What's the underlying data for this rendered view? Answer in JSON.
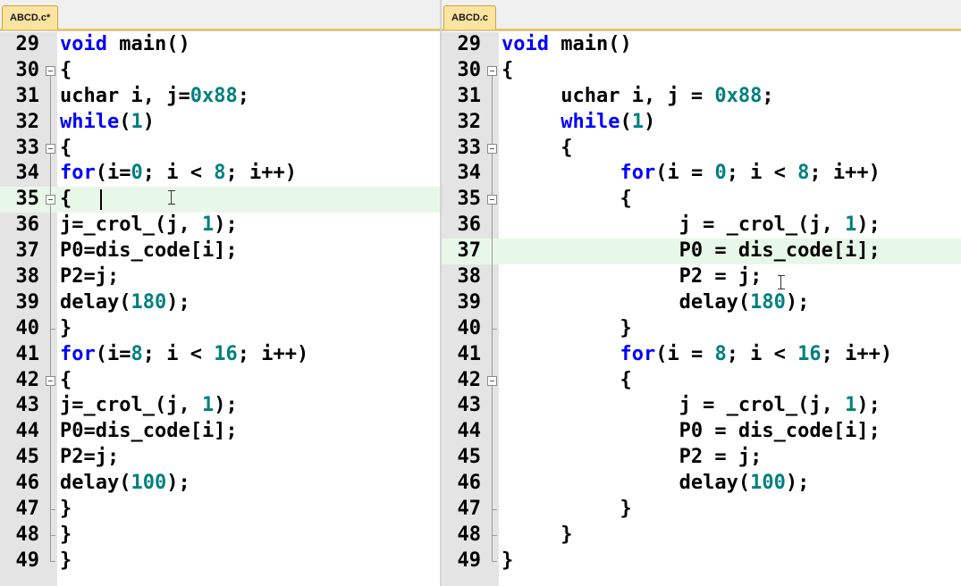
{
  "left_editor": {
    "tab_label": "ABCD.c*",
    "highlight_line": 35,
    "lines": [
      {
        "n": "29",
        "fold": "none",
        "t": [
          {
            "k": "kw",
            "v": "void"
          },
          {
            "k": "p",
            "v": " main()"
          }
        ]
      },
      {
        "n": "30",
        "fold": "open",
        "t": [
          {
            "k": "p",
            "v": "{"
          }
        ]
      },
      {
        "n": "31",
        "fold": "line",
        "t": [
          {
            "k": "p",
            "v": "uchar i, j="
          },
          {
            "k": "num",
            "v": "0x88"
          },
          {
            "k": "p",
            "v": ";"
          }
        ]
      },
      {
        "n": "32",
        "fold": "line",
        "t": [
          {
            "k": "kw",
            "v": "while"
          },
          {
            "k": "p",
            "v": "("
          },
          {
            "k": "num",
            "v": "1"
          },
          {
            "k": "p",
            "v": ")"
          }
        ]
      },
      {
        "n": "33",
        "fold": "open",
        "t": [
          {
            "k": "p",
            "v": "{"
          }
        ]
      },
      {
        "n": "34",
        "fold": "line",
        "t": [
          {
            "k": "kw",
            "v": "for"
          },
          {
            "k": "p",
            "v": "(i="
          },
          {
            "k": "num",
            "v": "0"
          },
          {
            "k": "p",
            "v": "; i < "
          },
          {
            "k": "num",
            "v": "8"
          },
          {
            "k": "p",
            "v": "; i++)"
          }
        ]
      },
      {
        "n": "35",
        "fold": "open",
        "t": [
          {
            "k": "p",
            "v": "{"
          }
        ]
      },
      {
        "n": "36",
        "fold": "line",
        "t": [
          {
            "k": "p",
            "v": "j=_crol_(j, "
          },
          {
            "k": "num",
            "v": "1"
          },
          {
            "k": "p",
            "v": ");"
          }
        ]
      },
      {
        "n": "37",
        "fold": "line",
        "t": [
          {
            "k": "p",
            "v": "P0=dis_code[i];"
          }
        ]
      },
      {
        "n": "38",
        "fold": "line",
        "t": [
          {
            "k": "p",
            "v": "P2=j;"
          }
        ]
      },
      {
        "n": "39",
        "fold": "line",
        "t": [
          {
            "k": "p",
            "v": "delay("
          },
          {
            "k": "num",
            "v": "180"
          },
          {
            "k": "p",
            "v": ");"
          }
        ]
      },
      {
        "n": "40",
        "fold": "end",
        "t": [
          {
            "k": "p",
            "v": "}"
          }
        ]
      },
      {
        "n": "41",
        "fold": "line",
        "t": [
          {
            "k": "kw",
            "v": "for"
          },
          {
            "k": "p",
            "v": "(i="
          },
          {
            "k": "num",
            "v": "8"
          },
          {
            "k": "p",
            "v": "; i < "
          },
          {
            "k": "num",
            "v": "16"
          },
          {
            "k": "p",
            "v": "; i++)"
          }
        ]
      },
      {
        "n": "42",
        "fold": "open",
        "t": [
          {
            "k": "p",
            "v": "{"
          }
        ]
      },
      {
        "n": "43",
        "fold": "line",
        "t": [
          {
            "k": "p",
            "v": "j=_crol_(j, "
          },
          {
            "k": "num",
            "v": "1"
          },
          {
            "k": "p",
            "v": ");"
          }
        ]
      },
      {
        "n": "44",
        "fold": "line",
        "t": [
          {
            "k": "p",
            "v": "P0=dis_code[i];"
          }
        ]
      },
      {
        "n": "45",
        "fold": "line",
        "t": [
          {
            "k": "p",
            "v": "P2=j;"
          }
        ]
      },
      {
        "n": "46",
        "fold": "line",
        "t": [
          {
            "k": "p",
            "v": "delay("
          },
          {
            "k": "num",
            "v": "100"
          },
          {
            "k": "p",
            "v": ");"
          }
        ]
      },
      {
        "n": "47",
        "fold": "end",
        "t": [
          {
            "k": "p",
            "v": "}"
          }
        ]
      },
      {
        "n": "48",
        "fold": "end",
        "t": [
          {
            "k": "p",
            "v": "}"
          }
        ]
      },
      {
        "n": "49",
        "fold": "last",
        "t": [
          {
            "k": "p",
            "v": "}"
          }
        ]
      }
    ]
  },
  "right_editor": {
    "tab_label": "ABCD.c",
    "highlight_line": 37,
    "lines": [
      {
        "n": "29",
        "fold": "none",
        "t": [
          {
            "k": "kw",
            "v": "void"
          },
          {
            "k": "p",
            "v": " main()"
          }
        ]
      },
      {
        "n": "30",
        "fold": "open",
        "t": [
          {
            "k": "p",
            "v": "{"
          }
        ]
      },
      {
        "n": "31",
        "fold": "line",
        "t": [
          {
            "k": "p",
            "v": "     uchar i, j = "
          },
          {
            "k": "num",
            "v": "0x88"
          },
          {
            "k": "p",
            "v": ";"
          }
        ]
      },
      {
        "n": "32",
        "fold": "line",
        "t": [
          {
            "k": "p",
            "v": "     "
          },
          {
            "k": "kw",
            "v": "while"
          },
          {
            "k": "p",
            "v": "("
          },
          {
            "k": "num",
            "v": "1"
          },
          {
            "k": "p",
            "v": ")"
          }
        ]
      },
      {
        "n": "33",
        "fold": "open",
        "t": [
          {
            "k": "p",
            "v": "     {"
          }
        ]
      },
      {
        "n": "34",
        "fold": "line",
        "t": [
          {
            "k": "p",
            "v": "          "
          },
          {
            "k": "kw",
            "v": "for"
          },
          {
            "k": "p",
            "v": "(i = "
          },
          {
            "k": "num",
            "v": "0"
          },
          {
            "k": "p",
            "v": "; i < "
          },
          {
            "k": "num",
            "v": "8"
          },
          {
            "k": "p",
            "v": "; i++)"
          }
        ]
      },
      {
        "n": "35",
        "fold": "open",
        "t": [
          {
            "k": "p",
            "v": "          {"
          }
        ]
      },
      {
        "n": "36",
        "fold": "line",
        "t": [
          {
            "k": "p",
            "v": "               j = _crol_(j, "
          },
          {
            "k": "num",
            "v": "1"
          },
          {
            "k": "p",
            "v": ");"
          }
        ]
      },
      {
        "n": "37",
        "fold": "line",
        "t": [
          {
            "k": "p",
            "v": "               P0 = dis_code[i];"
          }
        ]
      },
      {
        "n": "38",
        "fold": "line",
        "t": [
          {
            "k": "p",
            "v": "               P2 = j;"
          }
        ]
      },
      {
        "n": "39",
        "fold": "line",
        "t": [
          {
            "k": "p",
            "v": "               delay("
          },
          {
            "k": "num",
            "v": "180"
          },
          {
            "k": "p",
            "v": ");"
          }
        ]
      },
      {
        "n": "40",
        "fold": "end",
        "t": [
          {
            "k": "p",
            "v": "          }"
          }
        ]
      },
      {
        "n": "41",
        "fold": "line",
        "t": [
          {
            "k": "p",
            "v": "          "
          },
          {
            "k": "kw",
            "v": "for"
          },
          {
            "k": "p",
            "v": "(i = "
          },
          {
            "k": "num",
            "v": "8"
          },
          {
            "k": "p",
            "v": "; i < "
          },
          {
            "k": "num",
            "v": "16"
          },
          {
            "k": "p",
            "v": "; i++)"
          }
        ]
      },
      {
        "n": "42",
        "fold": "open",
        "t": [
          {
            "k": "p",
            "v": "          {"
          }
        ]
      },
      {
        "n": "43",
        "fold": "line",
        "t": [
          {
            "k": "p",
            "v": "               j = _crol_(j, "
          },
          {
            "k": "num",
            "v": "1"
          },
          {
            "k": "p",
            "v": ");"
          }
        ]
      },
      {
        "n": "44",
        "fold": "line",
        "t": [
          {
            "k": "p",
            "v": "               P0 = dis_code[i];"
          }
        ]
      },
      {
        "n": "45",
        "fold": "line",
        "t": [
          {
            "k": "p",
            "v": "               P2 = j;"
          }
        ]
      },
      {
        "n": "46",
        "fold": "line",
        "t": [
          {
            "k": "p",
            "v": "               delay("
          },
          {
            "k": "num",
            "v": "100"
          },
          {
            "k": "p",
            "v": ");"
          }
        ]
      },
      {
        "n": "47",
        "fold": "end",
        "t": [
          {
            "k": "p",
            "v": "          }"
          }
        ]
      },
      {
        "n": "48",
        "fold": "end",
        "t": [
          {
            "k": "p",
            "v": "     }"
          }
        ]
      },
      {
        "n": "49",
        "fold": "last",
        "t": [
          {
            "k": "p",
            "v": "}"
          }
        ]
      }
    ]
  },
  "colors": {
    "keyword": "#0000ff",
    "number": "#008080",
    "highlight": "#e8f8e8",
    "tab": "#fbe3a0"
  },
  "icons": [
    "fold-toggle-icon",
    "text-cursor-icon"
  ]
}
